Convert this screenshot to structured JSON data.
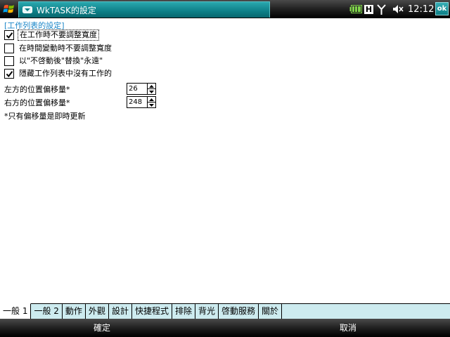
{
  "titlebar": {
    "start_icon": "windows-flag-icon",
    "app_icon": "wktask-app-icon",
    "title": "WkTASK的設定",
    "status_icons": [
      "battery-icon",
      "h-network-icon",
      "signal-antenna-icon",
      "speaker-volume-icon"
    ],
    "h_label": "H",
    "clock": "12:12",
    "ok_label": "ok"
  },
  "main": {
    "section_title": "[工作列表的設定]",
    "checkboxes": [
      {
        "label": "在工作時不要調整寬度",
        "checked": true
      },
      {
        "label": "在時間變動時不要調整寬度",
        "checked": false
      },
      {
        "label": "以\"不啓動後\"替換\"永遠\"",
        "checked": false
      },
      {
        "label": "隱藏工作列表中沒有工作的",
        "checked": true
      }
    ],
    "offsets": [
      {
        "label": "左方的位置偏移量*",
        "value": "26"
      },
      {
        "label": "右方的位置偏移量*",
        "value": "248"
      }
    ],
    "note": "*只有偏移量是即時更新"
  },
  "tabs": [
    {
      "label": "一般 1",
      "active": true
    },
    {
      "label": "一般 2",
      "active": false
    },
    {
      "label": "動作",
      "active": false
    },
    {
      "label": "外觀",
      "active": false
    },
    {
      "label": "設計",
      "active": false
    },
    {
      "label": "快捷程式",
      "active": false
    },
    {
      "label": "排除",
      "active": false
    },
    {
      "label": "背光",
      "active": false
    },
    {
      "label": "啓動服務",
      "active": false
    },
    {
      "label": "關於",
      "active": false
    }
  ],
  "softkeys": {
    "left": "確定",
    "right": "取消"
  },
  "colors": {
    "accent": "#0d7f87",
    "section_title": "#1a86c8",
    "tab_bg": "#cdebef"
  }
}
